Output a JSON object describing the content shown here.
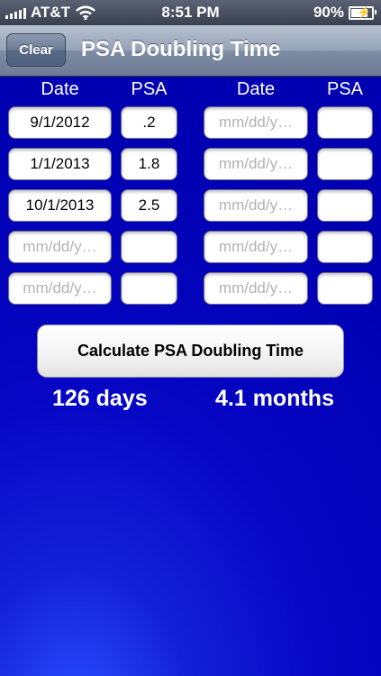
{
  "status": {
    "carrier": "AT&T",
    "time": "8:51 PM",
    "battery": "90%",
    "battery_level": 0.9
  },
  "nav": {
    "clear_label": "Clear",
    "title": "PSA Doubling Time"
  },
  "headers": {
    "date": "Date",
    "psa": "PSA"
  },
  "placeholder": "mm/dd/y…",
  "left_rows": [
    {
      "date": "9/1/2012",
      "psa": ".2"
    },
    {
      "date": "1/1/2013",
      "psa": "1.8"
    },
    {
      "date": "10/1/2013",
      "psa": "2.5"
    },
    {
      "date": "",
      "psa": ""
    },
    {
      "date": "",
      "psa": ""
    }
  ],
  "right_rows": [
    {
      "date": "",
      "psa": ""
    },
    {
      "date": "",
      "psa": ""
    },
    {
      "date": "",
      "psa": ""
    },
    {
      "date": "",
      "psa": ""
    },
    {
      "date": "",
      "psa": ""
    }
  ],
  "calc_label": "Calculate PSA Doubling Time",
  "results": {
    "days": "126 days",
    "months": "4.1 months"
  }
}
